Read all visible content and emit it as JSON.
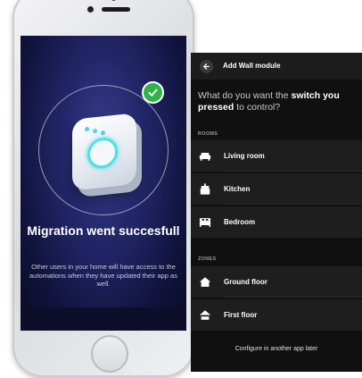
{
  "phone": {
    "migration_title": "Migration went succesfull",
    "migration_description": "Other users in your home will have access to the automations when they have updated their app as well."
  },
  "panel": {
    "header_title": "Add Wall module",
    "question_prefix": "What do you want the ",
    "question_bold": "switch you pressed",
    "question_suffix": " to control?",
    "rooms_label": "ROOMS",
    "zones_label": "ZONES",
    "rooms": [
      {
        "label": "Living room",
        "icon": "sofa-icon"
      },
      {
        "label": "Kitchen",
        "icon": "kitchen-icon"
      },
      {
        "label": "Bedroom",
        "icon": "bed-icon"
      }
    ],
    "zones": [
      {
        "label": "Ground floor",
        "icon": "home-icon"
      },
      {
        "label": "First floor",
        "icon": "house-floor-icon"
      }
    ],
    "configure_later": "Configure in another app later"
  },
  "colors": {
    "accent_cyan": "#48d6e8",
    "success_green": "#2fb34a",
    "panel_bg": "#101010",
    "row_bg": "#1e1e1e"
  }
}
